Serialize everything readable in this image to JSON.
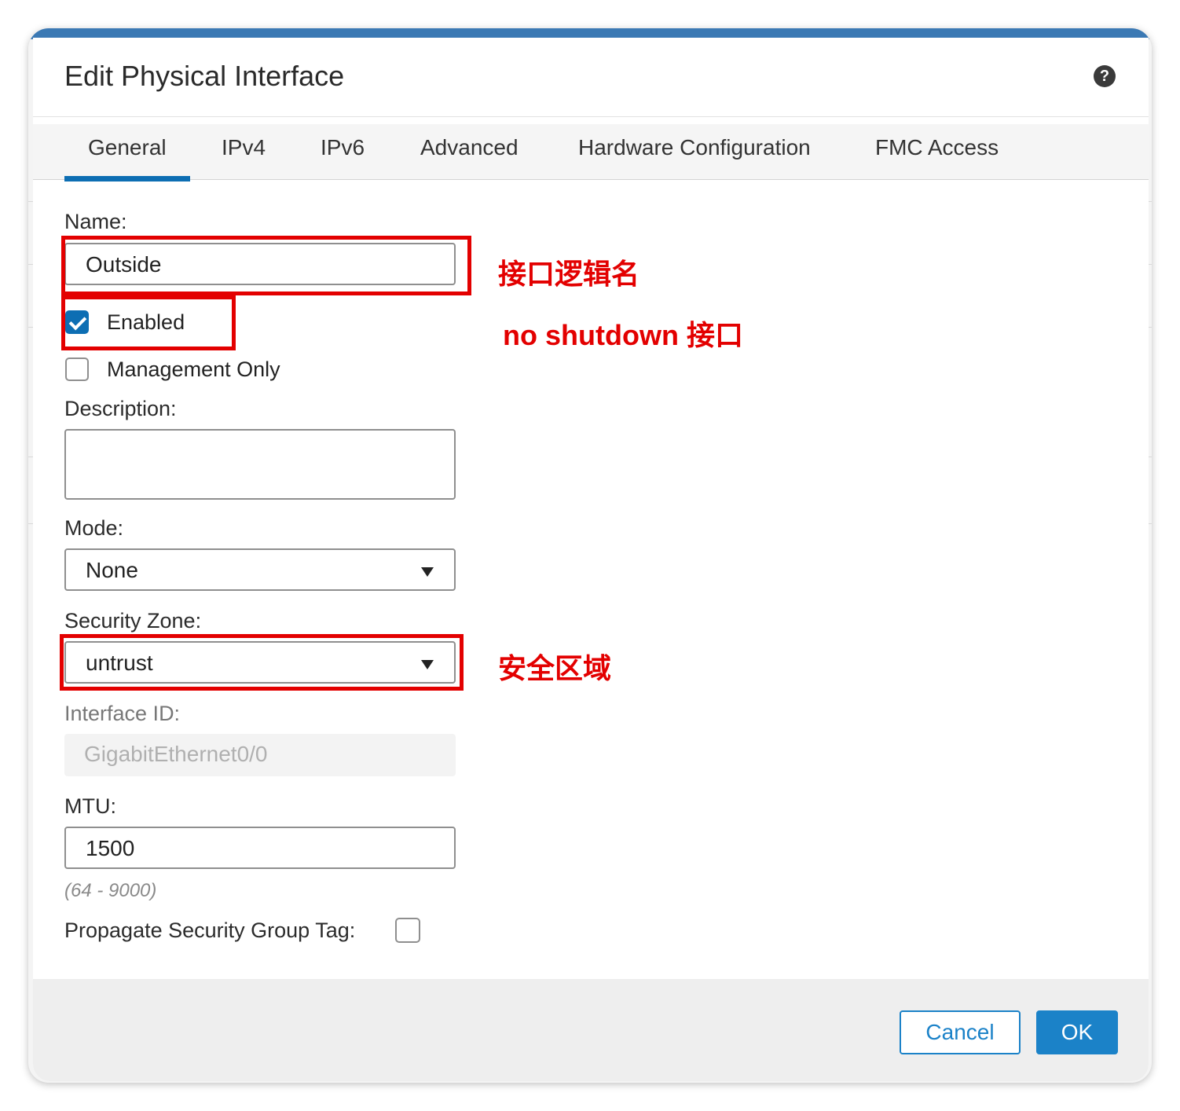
{
  "dialog": {
    "title": "Edit Physical Interface",
    "help_icon": "question-mark-icon"
  },
  "tabs": [
    {
      "label": "General",
      "active": true
    },
    {
      "label": "IPv4",
      "active": false
    },
    {
      "label": "IPv6",
      "active": false
    },
    {
      "label": "Advanced",
      "active": false
    },
    {
      "label": "Hardware Configuration",
      "active": false
    },
    {
      "label": "FMC Access",
      "active": false
    }
  ],
  "form": {
    "name_label": "Name:",
    "name_value": "Outside",
    "enabled_label": "Enabled",
    "enabled_checked": true,
    "management_only_label": "Management Only",
    "management_only_checked": false,
    "description_label": "Description:",
    "description_value": "",
    "mode_label": "Mode:",
    "mode_value": "None",
    "security_zone_label": "Security Zone:",
    "security_zone_value": "untrust",
    "interface_id_label": "Interface ID:",
    "interface_id_value": "GigabitEthernet0/0",
    "mtu_label": "MTU:",
    "mtu_value": "1500",
    "mtu_hint": "(64 - 9000)",
    "propagate_sgt_label": "Propagate Security Group Tag:",
    "propagate_sgt_checked": false
  },
  "annotations": {
    "name": "接口逻辑名",
    "enabled": "no shutdown 接口",
    "zone": "安全区域",
    "color": "#e30000"
  },
  "footer": {
    "cancel_label": "Cancel",
    "ok_label": "OK"
  },
  "colors": {
    "accent": "#0d6eb3",
    "button": "#1b82c8"
  }
}
